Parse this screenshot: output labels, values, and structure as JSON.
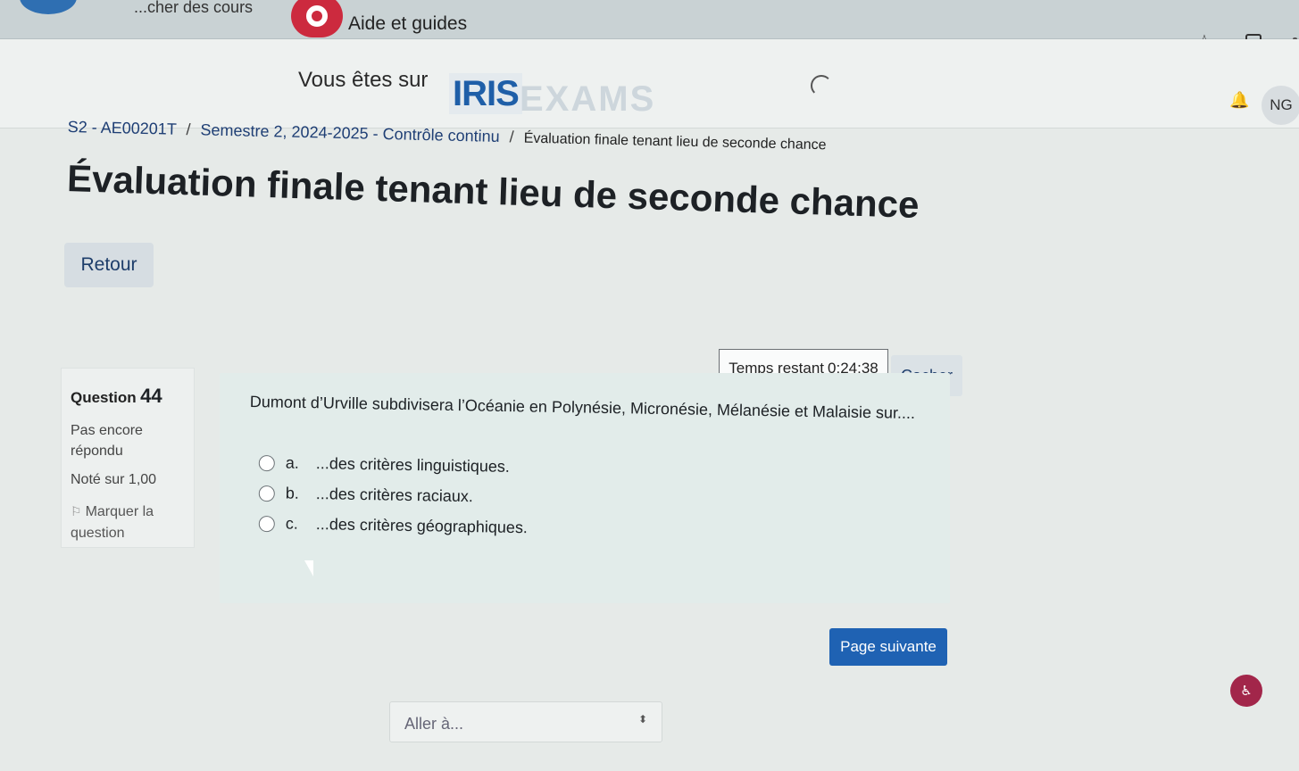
{
  "browser": {
    "top_link_courses": "...cher des cours",
    "top_link_help": "Aide et guides"
  },
  "header": {
    "site_prefix": "Vous êtes sur",
    "logo_part1": "IRIS",
    "logo_part2": "EXAMS",
    "user_initials": "NG"
  },
  "breadcrumb": {
    "items": [
      "S2 - AE00201T",
      "Semestre 2, 2024-2025 - Contrôle continu",
      "Évaluation finale tenant lieu de seconde chance"
    ],
    "separator": "/"
  },
  "page": {
    "title": "Évaluation finale tenant lieu de seconde chance",
    "back_label": "Retour"
  },
  "timer": {
    "label": "Temps restant",
    "value": "0:24:38",
    "hide_label": "Cacher"
  },
  "question": {
    "number_label": "Question",
    "number": "44",
    "state": "Pas encore répondu",
    "grade": "Noté sur 1,00",
    "flag_label": "Marquer la question",
    "text": "Dumont d’Urville subdivisera l’Océanie en Polynésie, Micronésie, Mélanésie et Malaisie sur....",
    "answers": [
      {
        "letter": "a.",
        "text": "...des critères linguistiques."
      },
      {
        "letter": "b.",
        "text": "...des critères raciaux."
      },
      {
        "letter": "c.",
        "text": "...des critères géographiques."
      }
    ]
  },
  "navigation": {
    "next_label": "Page suivante",
    "jump_placeholder": "Aller à..."
  },
  "colors": {
    "primary": "#1f62b3",
    "help_red": "#cc2a3e",
    "accessibility": "#a2264a"
  }
}
